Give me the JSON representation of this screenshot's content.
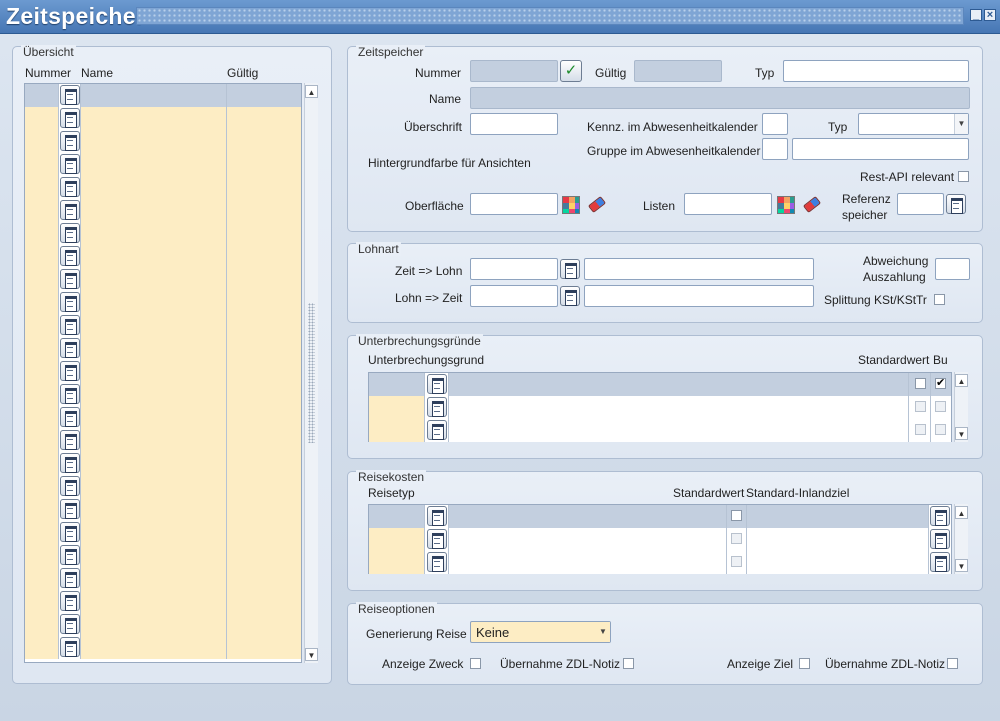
{
  "window": {
    "title": "Zeitspeicher",
    "minimize_icon": "minimize-icon",
    "close_icon": "close-icon"
  },
  "overview": {
    "title": "Übersicht",
    "columns": [
      "Nummer",
      "Name",
      "Gültig"
    ],
    "row_count": 25
  },
  "zeitspeicher": {
    "title": "Zeitspeicher",
    "nummer_label": "Nummer",
    "gueltig_label": "Gültig",
    "typ_label": "Typ",
    "name_label": "Name",
    "ueberschrift_label": "Überschrift",
    "kennz_label": "Kennz. im Abwesenheitkalender",
    "typ2_label": "Typ",
    "gruppe_label": "Gruppe im Abwesenheitkalender",
    "hintergrund_label": "Hintergrundfarbe für Ansichten",
    "restapi_label": "Rest-API relevant",
    "oberflaeche_label": "Oberfläche",
    "listen_label": "Listen",
    "referenz_label_1": "Referenz",
    "referenz_label_2": "speicher"
  },
  "lohnart": {
    "title": "Lohnart",
    "zeit_lohn_label": "Zeit => Lohn",
    "lohn_zeit_label": "Lohn => Zeit",
    "abweichung_label_1": "Abweichung",
    "abweichung_label_2": "Auszahlung",
    "splitting_label": "Splittung KSt/KStTr"
  },
  "unterbrechung": {
    "title": "Unterbrechungsgründe",
    "col_grund": "Unterbrechungsgrund",
    "col_standard": "Standardwert",
    "col_bu": "Bu",
    "row_count": 3
  },
  "reisekosten": {
    "title": "Reisekosten",
    "col_typ": "Reisetyp",
    "col_standard": "Standardwert",
    "col_inland": "Standard-Inlandziel",
    "row_count": 3
  },
  "reiseoptionen": {
    "title": "Reiseoptionen",
    "generierung_label": "Generierung Reise",
    "generierung_value": "Keine",
    "anzeige_zweck_label": "Anzeige Zweck",
    "uebernahme1_label": "Übernahme ZDL-Notiz",
    "anzeige_ziel_label": "Anzeige Ziel",
    "uebernahme2_label": "Übernahme ZDL-Notiz"
  },
  "colors": {
    "titlebar": "#4676b4",
    "row_yellow": "#fdedc4",
    "row_selected": "#c3cfdf"
  }
}
